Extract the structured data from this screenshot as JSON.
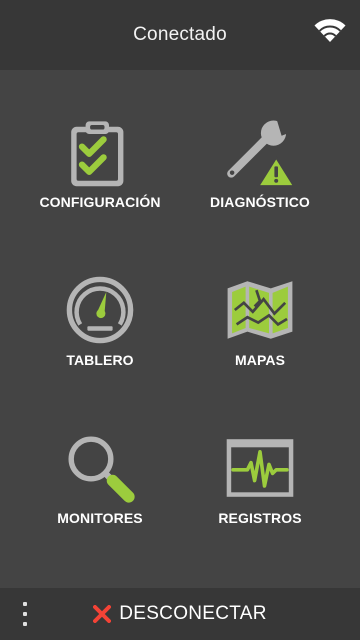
{
  "header": {
    "title": "Conectado",
    "wifi_icon": "wifi-icon"
  },
  "colors": {
    "accent": "#9ccc3d",
    "icon_gray": "#b5b5b5",
    "background": "#444444",
    "bar": "#373737",
    "warning": "#f44336"
  },
  "tiles": [
    {
      "label": "CONFIGURACIÓN",
      "icon": "clipboard-check-icon"
    },
    {
      "label": "DIAGNÓSTICO",
      "icon": "wrench-warning-icon"
    },
    {
      "label": "TABLERO",
      "icon": "speedometer-icon"
    },
    {
      "label": "MAPAS",
      "icon": "map-icon"
    },
    {
      "label": "MONITORES",
      "icon": "magnifier-icon"
    },
    {
      "label": "REGISTROS",
      "icon": "waveform-log-icon"
    }
  ],
  "footer": {
    "menu_icon": "more-vert-icon",
    "disconnect_label": "DESCONECTAR",
    "disconnect_icon": "close-icon"
  }
}
